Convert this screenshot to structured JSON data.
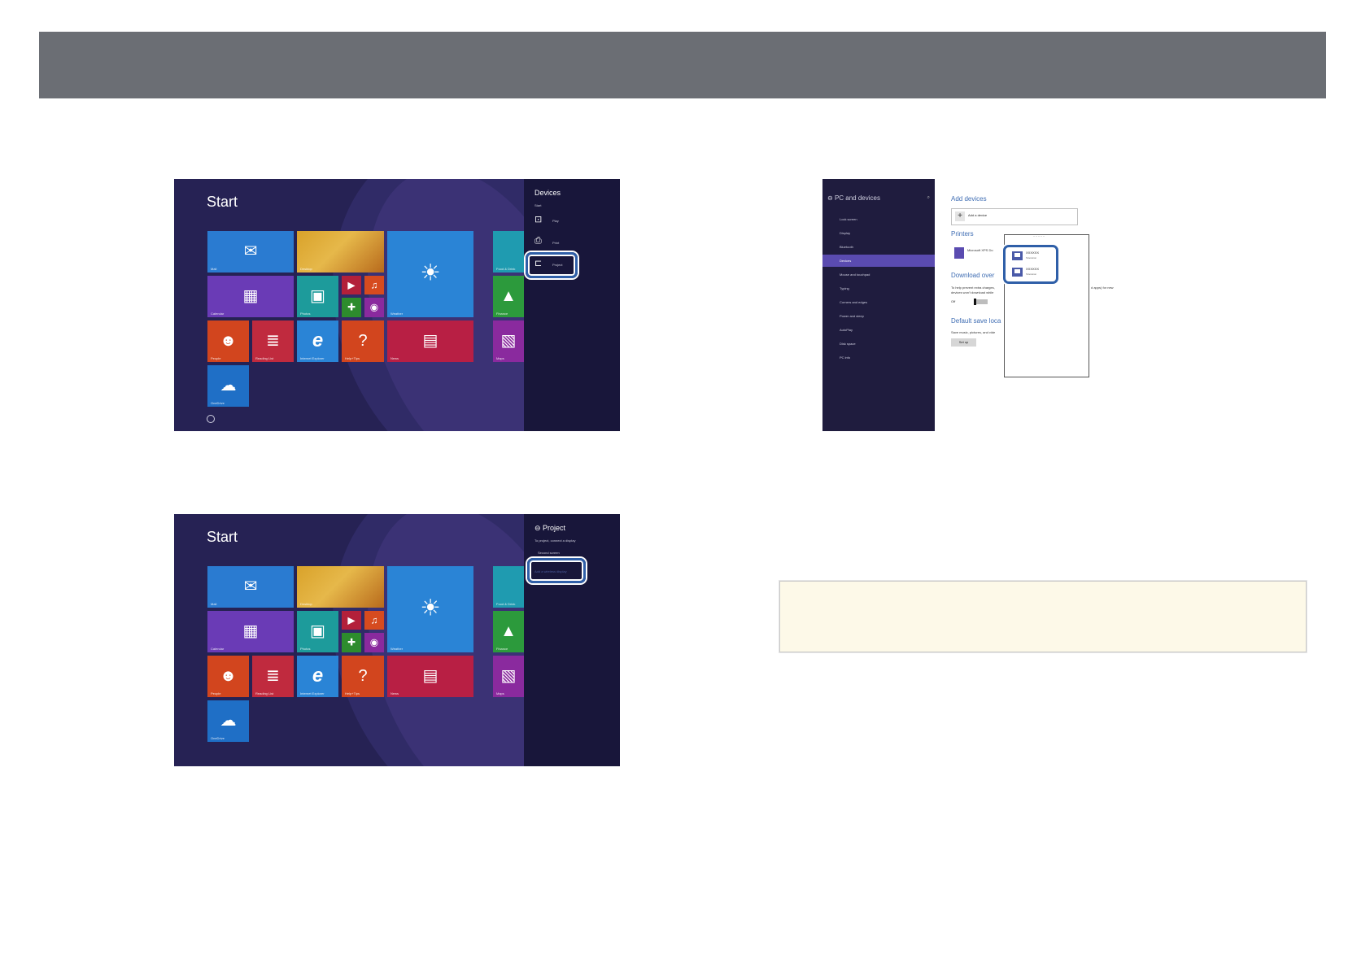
{
  "start_screen": {
    "title": "Start",
    "tiles": [
      {
        "label": "Mail",
        "icon": "mail-icon",
        "glyph": "✉"
      },
      {
        "label": "Desktop",
        "icon": "desktop-icon",
        "glyph": ""
      },
      {
        "label": "Weather",
        "icon": "weather-icon",
        "glyph": "☀"
      },
      {
        "label": "Food & Drink",
        "icon": "food-icon",
        "glyph": ""
      },
      {
        "label": "Calendar",
        "icon": "calendar-icon",
        "glyph": "▦"
      },
      {
        "label": "Photos",
        "icon": "photos-icon",
        "glyph": "▣"
      },
      {
        "label": "Video",
        "icon": "video-icon",
        "glyph": "▶"
      },
      {
        "label": "Music",
        "icon": "music-icon",
        "glyph": "♫"
      },
      {
        "label": "Games",
        "icon": "games-icon",
        "glyph": "✚"
      },
      {
        "label": "Camera",
        "icon": "camera-icon",
        "glyph": "◉"
      },
      {
        "label": "Finance",
        "icon": "finance-icon",
        "glyph": "▲"
      },
      {
        "label": "People",
        "icon": "people-icon",
        "glyph": "☻"
      },
      {
        "label": "Reading List",
        "icon": "reading-list-icon",
        "glyph": "≣"
      },
      {
        "label": "Internet Explorer",
        "icon": "internet-explorer-icon",
        "glyph": "e"
      },
      {
        "label": "Help+Tips",
        "icon": "help-icon",
        "glyph": "?"
      },
      {
        "label": "News",
        "icon": "news-icon",
        "glyph": "▤"
      },
      {
        "label": "Maps",
        "icon": "maps-icon",
        "glyph": "▧"
      },
      {
        "label": "OneDrive",
        "icon": "onedrive-icon",
        "glyph": "☁"
      }
    ]
  },
  "devices_charm": {
    "title": "Devices",
    "subtitle": "Start",
    "items": [
      {
        "label": "Play",
        "icon": "play-device-icon",
        "glyph": "⊡"
      },
      {
        "label": "Print",
        "icon": "print-icon",
        "glyph": "⎙"
      },
      {
        "label": "Project",
        "icon": "project-icon",
        "glyph": "⊏"
      }
    ]
  },
  "project_charm": {
    "title": "Project",
    "subtitle": "To project, connect a display",
    "items": [
      {
        "label": "Second screen"
      },
      {
        "label": "Add a wireless display"
      }
    ]
  },
  "pc_settings": {
    "title": "PC and devices",
    "nav": [
      "Lock screen",
      "Display",
      "Bluetooth",
      "Devices",
      "Mouse and touchpad",
      "Typing",
      "Corners and edges",
      "Power and sleep",
      "AutoPlay",
      "Disk space",
      "PC info"
    ],
    "active_nav": "Devices",
    "add_devices_heading": "Add devices",
    "add_device_label": "Add a device",
    "printers_heading": "Printers",
    "printer_name": "Microsoft XPS Do",
    "download_heading": "Download over",
    "download_text_1": "To help prevent extra charges,",
    "download_text_2": "devices won't download while",
    "download_text_right": "d apps) for new",
    "toggle_label": "Off",
    "save_heading": "Default save loca",
    "save_text": "Save music, pictures, and vide",
    "setup_label": "Set up",
    "found_devices": [
      {
        "name": "XXXXXX",
        "type": "Television"
      },
      {
        "name": "XXXXXX",
        "type": "Television"
      }
    ]
  },
  "colors": {
    "header_bar": "#6b6e74",
    "highlight": "#2f5fa8",
    "note_background": "#fdf9e8"
  }
}
